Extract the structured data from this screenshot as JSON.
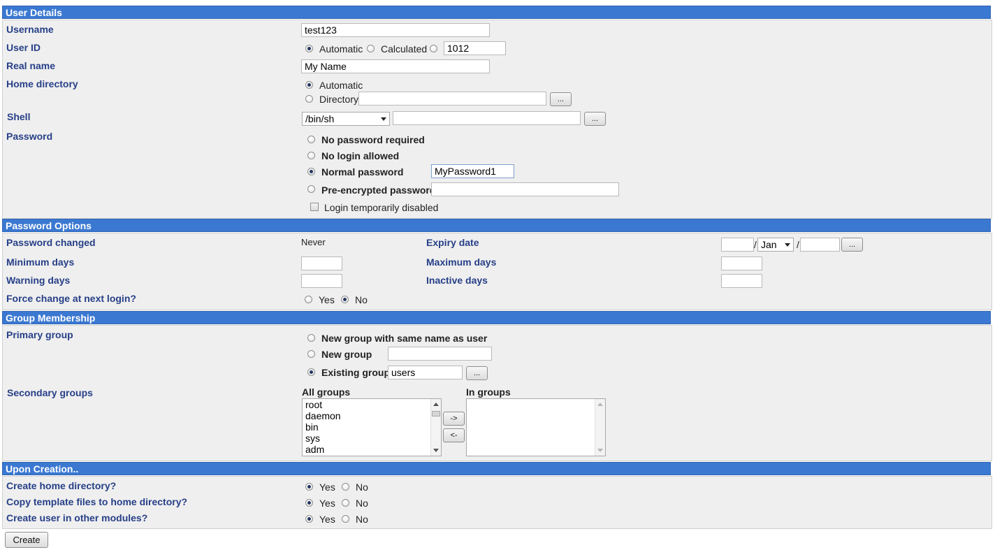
{
  "sections": {
    "user_details": "User Details",
    "password_options": "Password Options",
    "group_membership": "Group Membership",
    "upon_creation": "Upon Creation.."
  },
  "user_details": {
    "username_label": "Username",
    "username_value": "test123",
    "userid_label": "User ID",
    "userid_automatic": "Automatic",
    "userid_calculated": "Calculated",
    "userid_value": "1012",
    "userid_selected": "automatic",
    "realname_label": "Real name",
    "realname_value": "My Name",
    "homedir_label": "Home directory",
    "homedir_automatic": "Automatic",
    "homedir_directory": "Directory",
    "homedir_value": "",
    "homedir_selected": "automatic",
    "browse": "...",
    "shell_label": "Shell",
    "shell_value": "/bin/sh",
    "shell_other_value": "",
    "password_label": "Password",
    "pw_none": "No password required",
    "pw_nologin": "No login allowed",
    "pw_normal": "Normal password",
    "pw_normal_value": "MyPassword1",
    "pw_preenc": "Pre-encrypted password",
    "pw_preenc_value": "",
    "pw_selected": "normal",
    "login_disabled": "Login temporarily disabled",
    "login_disabled_checked": false
  },
  "password_options": {
    "changed_label": "Password changed",
    "changed_value": "Never",
    "expiry_label": "Expiry date",
    "expiry_day": "",
    "expiry_month": "Jan",
    "expiry_year": "",
    "sep": "/",
    "min_label": "Minimum days",
    "min_value": "",
    "max_label": "Maximum days",
    "max_value": "",
    "warn_label": "Warning days",
    "warn_value": "",
    "inactive_label": "Inactive days",
    "inactive_value": "",
    "force_label": "Force change at next login?",
    "yes": "Yes",
    "no": "No",
    "force_selected": "no"
  },
  "group_membership": {
    "primary_label": "Primary group",
    "new_same": "New group with same name as user",
    "new_group": "New group",
    "new_group_value": "",
    "existing_group": "Existing group",
    "existing_group_value": "users",
    "primary_selected": "existing",
    "secondary_label": "Secondary groups",
    "all_groups_label": "All groups",
    "in_groups_label": "In groups",
    "all_groups": [
      "root",
      "daemon",
      "bin",
      "sys",
      "adm"
    ],
    "in_groups": [],
    "add_btn": "->",
    "remove_btn": "<-"
  },
  "upon_creation": {
    "create_home_label": "Create home directory?",
    "copy_template_label": "Copy template files to home directory?",
    "other_modules_label": "Create user in other modules?",
    "yes": "Yes",
    "no": "No",
    "create_home_selected": "yes",
    "copy_template_selected": "yes",
    "other_modules_selected": "yes"
  },
  "create_button": "Create"
}
